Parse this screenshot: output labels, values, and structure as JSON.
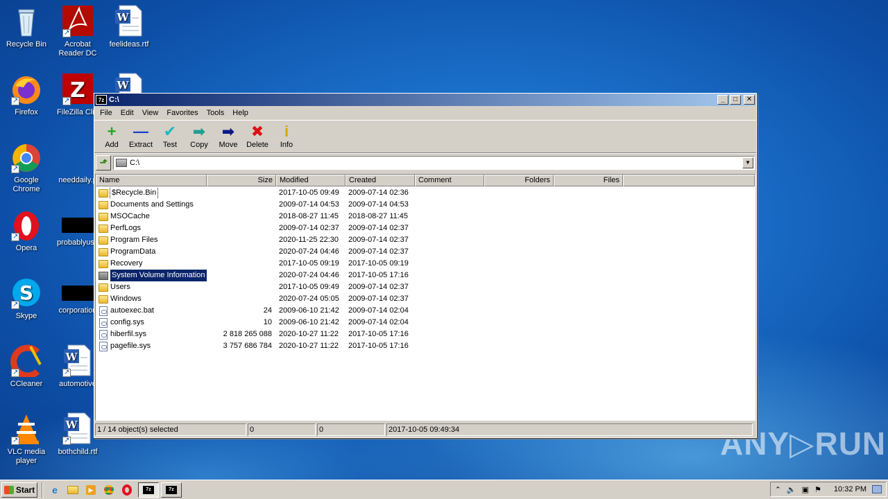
{
  "desktop": {
    "icons": [
      {
        "label": "Recycle Bin",
        "icon": "recycle-bin-icon"
      },
      {
        "label": "Acrobat\nReader DC",
        "icon": "acrobat-icon"
      },
      {
        "label": "feelideas.rtf",
        "icon": "word-doc-icon"
      },
      {
        "label": "Firefox",
        "icon": "firefox-icon"
      },
      {
        "label": "FileZilla Clie",
        "icon": "filezilla-icon"
      },
      {
        "label": "Google\nChrome",
        "icon": "chrome-icon"
      },
      {
        "label": "needdaily.p",
        "icon": "file-icon"
      },
      {
        "label": "Opera",
        "icon": "opera-icon"
      },
      {
        "label": "probablyuse",
        "icon": "file-icon"
      },
      {
        "label": "Skype",
        "icon": "skype-icon"
      },
      {
        "label": "corporation",
        "icon": "file-icon"
      },
      {
        "label": "CCleaner",
        "icon": "ccleaner-icon"
      },
      {
        "label": "automotive",
        "icon": "word-doc-icon"
      },
      {
        "label": "VLC media\nplayer",
        "icon": "vlc-icon"
      },
      {
        "label": "bothchild.rtf",
        "icon": "word-doc-icon"
      }
    ]
  },
  "window": {
    "title": "C:\\",
    "app_icon": "7z",
    "menu": [
      "File",
      "Edit",
      "View",
      "Favorites",
      "Tools",
      "Help"
    ],
    "toolbar": [
      {
        "label": "Add",
        "icon": "add-icon",
        "glyph": "+",
        "color": "#1fa81f"
      },
      {
        "label": "Extract",
        "icon": "extract-icon",
        "glyph": "—",
        "color": "#1a3fd0"
      },
      {
        "label": "Test",
        "icon": "test-icon",
        "glyph": "✔",
        "color": "#20b8c0"
      },
      {
        "label": "Copy",
        "icon": "copy-icon",
        "glyph": "➡",
        "color": "#20a090"
      },
      {
        "label": "Move",
        "icon": "move-icon",
        "glyph": "➡",
        "color": "#0a1a8a"
      },
      {
        "label": "Delete",
        "icon": "delete-icon",
        "glyph": "✖",
        "color": "#e01010"
      },
      {
        "label": "Info",
        "icon": "info-icon",
        "glyph": "i",
        "color": "#d0a800"
      }
    ],
    "address": "C:\\",
    "columns": [
      "Name",
      "Size",
      "Modified",
      "Created",
      "Comment",
      "Folders",
      "Files"
    ],
    "rows": [
      {
        "name": "$Recycle.Bin",
        "size": "",
        "modified": "2017-10-05 09:49",
        "created": "2009-07-14 02:36",
        "type": "folder",
        "state": "focus"
      },
      {
        "name": "Documents and Settings",
        "size": "",
        "modified": "2009-07-14 04:53",
        "created": "2009-07-14 04:53",
        "type": "folder",
        "state": ""
      },
      {
        "name": "MSOCache",
        "size": "",
        "modified": "2018-08-27 11:45",
        "created": "2018-08-27 11:45",
        "type": "folder",
        "state": ""
      },
      {
        "name": "PerfLogs",
        "size": "",
        "modified": "2009-07-14 02:37",
        "created": "2009-07-14 02:37",
        "type": "folder",
        "state": ""
      },
      {
        "name": "Program Files",
        "size": "",
        "modified": "2020-11-25 22:30",
        "created": "2009-07-14 02:37",
        "type": "folder",
        "state": ""
      },
      {
        "name": "ProgramData",
        "size": "",
        "modified": "2020-07-24 04:46",
        "created": "2009-07-14 02:37",
        "type": "folder",
        "state": ""
      },
      {
        "name": "Recovery",
        "size": "",
        "modified": "2017-10-05 09:19",
        "created": "2017-10-05 09:19",
        "type": "folder",
        "state": ""
      },
      {
        "name": "System Volume Information",
        "size": "",
        "modified": "2020-07-24 04:46",
        "created": "2017-10-05 17:16",
        "type": "folder-gray",
        "state": "selected"
      },
      {
        "name": "Users",
        "size": "",
        "modified": "2017-10-05 09:49",
        "created": "2009-07-14 02:37",
        "type": "folder",
        "state": ""
      },
      {
        "name": "Windows",
        "size": "",
        "modified": "2020-07-24 05:05",
        "created": "2009-07-14 02:37",
        "type": "folder",
        "state": ""
      },
      {
        "name": "autoexec.bat",
        "size": "24",
        "modified": "2009-06-10 21:42",
        "created": "2009-07-14 02:04",
        "type": "file",
        "state": ""
      },
      {
        "name": "config.sys",
        "size": "10",
        "modified": "2009-06-10 21:42",
        "created": "2009-07-14 02:04",
        "type": "file",
        "state": ""
      },
      {
        "name": "hiberfil.sys",
        "size": "2 818 265 088",
        "modified": "2020-10-27 11:22",
        "created": "2017-10-05 17:16",
        "type": "file",
        "state": ""
      },
      {
        "name": "pagefile.sys",
        "size": "3 757 686 784",
        "modified": "2020-10-27 11:22",
        "created": "2017-10-05 17:16",
        "type": "file",
        "state": ""
      }
    ],
    "status": {
      "selection": "1 / 14 object(s) selected",
      "size1": "0",
      "size2": "0",
      "date": "2017-10-05 09:49:34"
    }
  },
  "taskbar": {
    "start_label": "Start",
    "clock": "10:32 PM",
    "task_label": "7z"
  },
  "watermark": "ANY▷RUN"
}
